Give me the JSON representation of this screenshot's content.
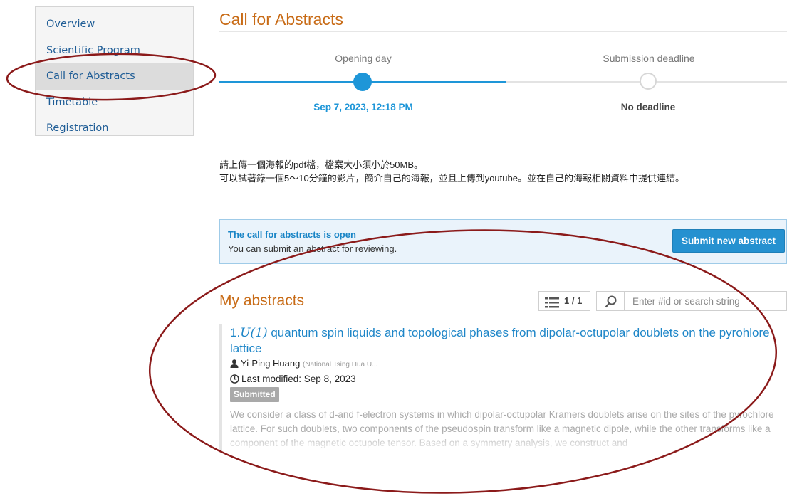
{
  "sidebar": {
    "items": [
      {
        "label": "Overview"
      },
      {
        "label": "Scientific Program"
      },
      {
        "label": "Call for Abstracts",
        "active": true
      },
      {
        "label": "Timetable"
      },
      {
        "label": "Registration"
      }
    ]
  },
  "page": {
    "title": "Call for Abstracts"
  },
  "timeline": {
    "steps": [
      {
        "label": "Opening day",
        "date": "Sep 7, 2023, 12:18 PM",
        "reached": true
      },
      {
        "label": "Submission deadline",
        "date": "No deadline",
        "reached": false
      }
    ]
  },
  "intro": {
    "line1": "請上傳一個海報的pdf檔，檔案大小須小於50MB。",
    "line2": "可以試著錄一個5～10分鐘的影片，簡介自己的海報，並且上傳到youtube。並在自己的海報相關資料中提供連結。"
  },
  "call_box": {
    "title": "The call for abstracts is open",
    "subtitle": "You can submit an abstract for reviewing.",
    "button": "Submit new abstract"
  },
  "my_abstracts": {
    "heading": "My abstracts",
    "pager": "1 / 1",
    "search_placeholder": "Enter #id or search string",
    "items": [
      {
        "number": "1.",
        "title_math": "U(1)",
        "title_rest": " quantum spin liquids and topological phases from dipolar-octupolar doublets on the pyrohlore lattice",
        "author": "Yi-Ping Huang",
        "affiliation": "(National Tsing Hua U...",
        "modified": "Last modified: Sep 8, 2023",
        "status": "Submitted",
        "abstract_text": "We consider a class of d-and f-electron systems in which dipolar-octupolar Kramers doublets arise on the sites of the pyrochlore lattice. For such doublets, two components of the pseudospin transform like a magnetic dipole, while the other transforms like a component of the magnetic octupole tensor. Based on a symmetry analysis, we construct and"
      }
    ]
  },
  "colors": {
    "accent_orange": "#c86b16",
    "link_blue": "#1e86c8",
    "timeline_blue": "#1e96d8",
    "annotation_red": "#8b1a1a"
  }
}
